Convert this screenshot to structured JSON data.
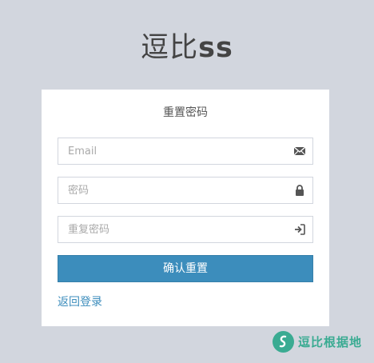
{
  "logo": {
    "prefix": "逗比",
    "suffix": "ss"
  },
  "form": {
    "title": "重置密码",
    "email_placeholder": "Email",
    "password_placeholder": "密码",
    "repeat_password_placeholder": "重复密码",
    "submit_label": "确认重置",
    "back_link": "返回登录"
  },
  "watermark": {
    "text": "逗比根据地"
  },
  "icons": {
    "email": "envelope-icon",
    "password": "lock-icon",
    "repeat_password": "sign-in-icon"
  },
  "colors": {
    "background": "#d2d6de",
    "primary": "#3c8dbc",
    "watermark": "#3aab92"
  }
}
